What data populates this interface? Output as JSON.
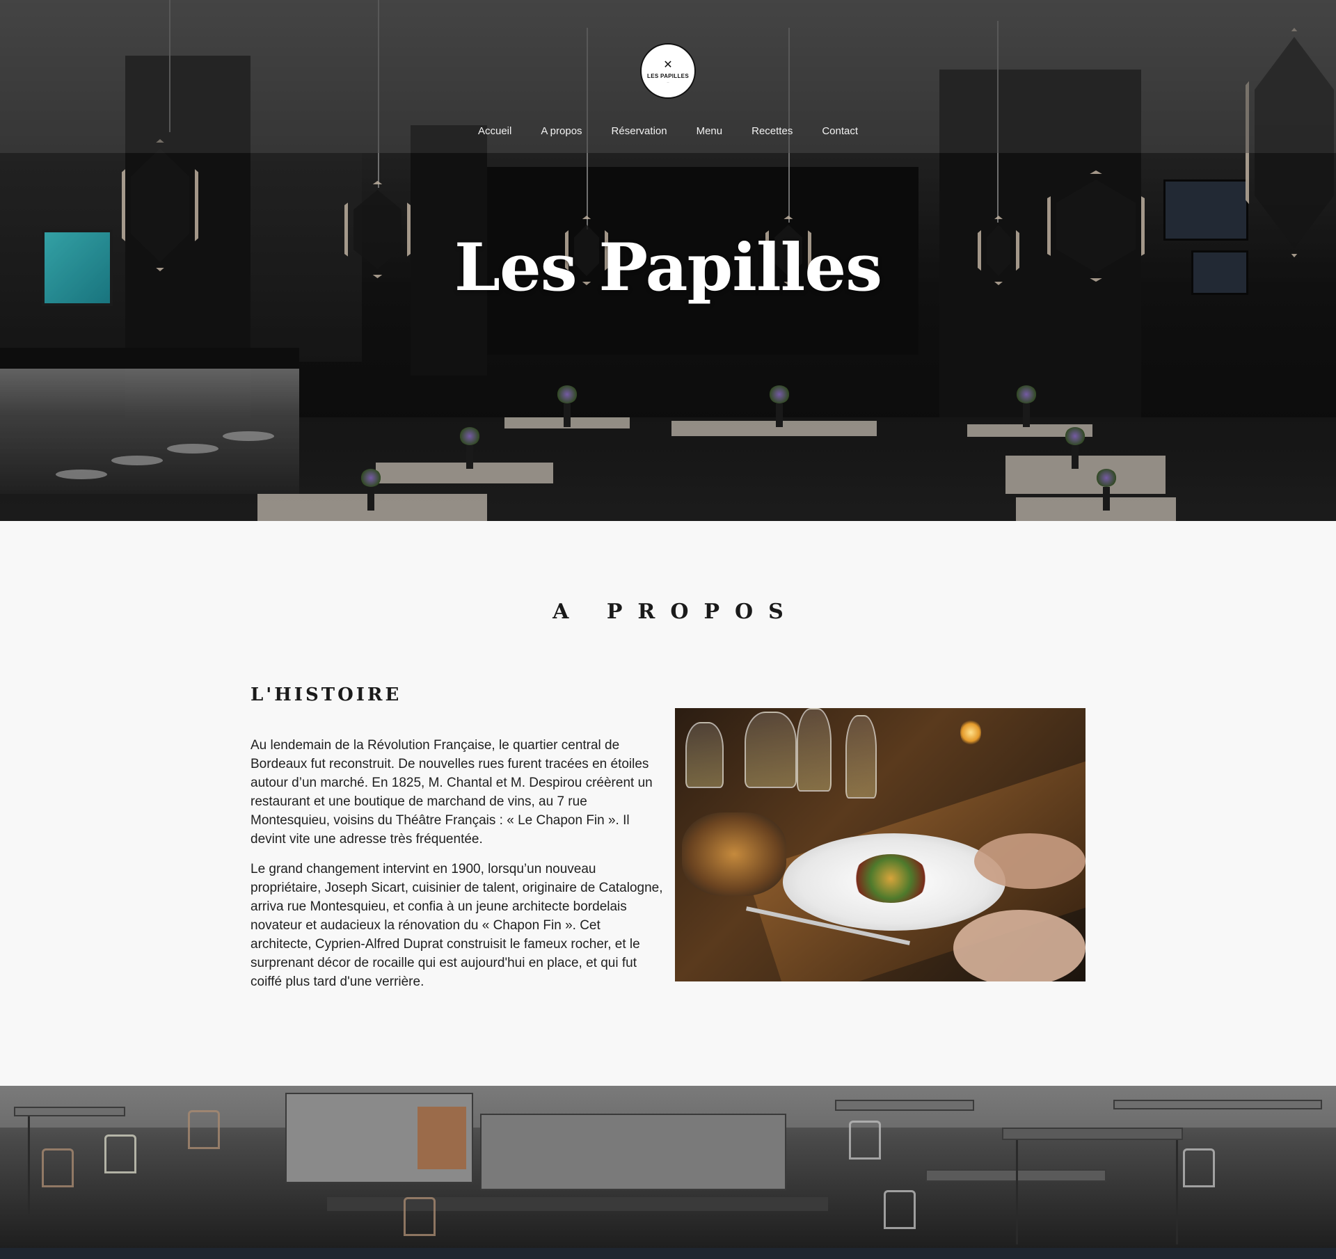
{
  "brand": {
    "logo_text": "LES PAPILLES",
    "logo_utensils": "✕"
  },
  "nav": {
    "items": [
      {
        "label": "Accueil"
      },
      {
        "label": "A propos"
      },
      {
        "label": "Réservation"
      },
      {
        "label": "Menu"
      },
      {
        "label": "Recettes"
      },
      {
        "label": "Contact"
      }
    ]
  },
  "hero": {
    "title": "Les Papilles"
  },
  "about": {
    "section_title": "A PROPOS",
    "subtitle": "L'HISTOIRE",
    "paragraphs": [
      "Au lendemain de la Révolution Française, le quartier central de Bordeaux fut reconstruit. De nouvelles rues furent tracées en étoiles autour d’un marché. En 1825, M. Chantal et M. Despirou créèrent un restaurant et une boutique de marchand de vins, au 7 rue Montesquieu, voisins du Théâtre Français : « Le Chapon Fin ». Il devint vite une adresse très fréquentée.",
      "Le grand changement intervint en 1900, lorsqu’un nouveau propriétaire, Joseph Sicart, cuisinier de talent, originaire de Catalogne, arriva rue Montesquieu, et confia à un jeune architecte bordelais novateur et audacieux la rénovation du « Chapon Fin ». Cet architecte, Cyprien-Alfred Duprat construisit le fameux rocher, et le surprenant décor de rocaille qui est aujourd'hui en place, et qui fut coiffé plus tard d'une verrière."
    ]
  },
  "colors": {
    "page_bg": "#f8f8f8",
    "text": "#1f1f1f",
    "hero_title": "#ffffff",
    "nav_text": "#f2f2f2"
  }
}
